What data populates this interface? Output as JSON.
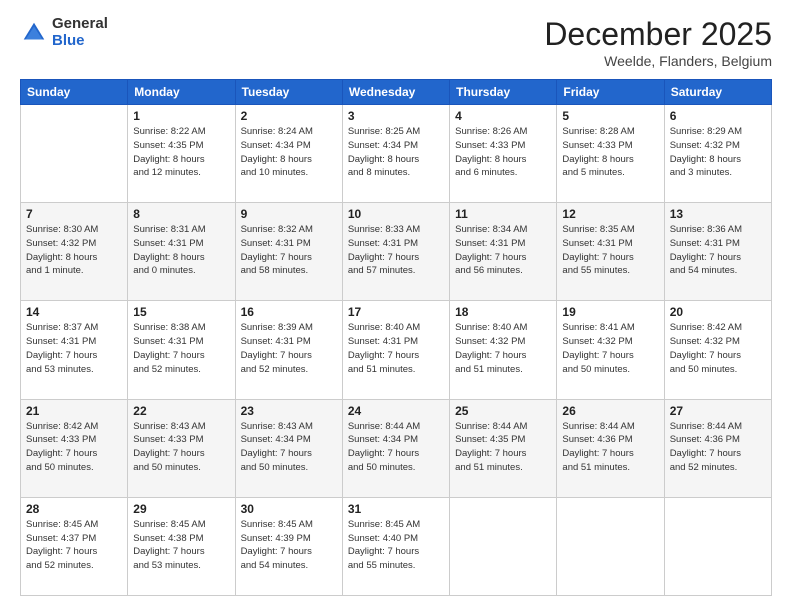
{
  "logo": {
    "general": "General",
    "blue": "Blue"
  },
  "header": {
    "month": "December 2025",
    "location": "Weelde, Flanders, Belgium"
  },
  "days_of_week": [
    "Sunday",
    "Monday",
    "Tuesday",
    "Wednesday",
    "Thursday",
    "Friday",
    "Saturday"
  ],
  "weeks": [
    [
      {
        "day": "",
        "info": ""
      },
      {
        "day": "1",
        "info": "Sunrise: 8:22 AM\nSunset: 4:35 PM\nDaylight: 8 hours\nand 12 minutes."
      },
      {
        "day": "2",
        "info": "Sunrise: 8:24 AM\nSunset: 4:34 PM\nDaylight: 8 hours\nand 10 minutes."
      },
      {
        "day": "3",
        "info": "Sunrise: 8:25 AM\nSunset: 4:34 PM\nDaylight: 8 hours\nand 8 minutes."
      },
      {
        "day": "4",
        "info": "Sunrise: 8:26 AM\nSunset: 4:33 PM\nDaylight: 8 hours\nand 6 minutes."
      },
      {
        "day": "5",
        "info": "Sunrise: 8:28 AM\nSunset: 4:33 PM\nDaylight: 8 hours\nand 5 minutes."
      },
      {
        "day": "6",
        "info": "Sunrise: 8:29 AM\nSunset: 4:32 PM\nDaylight: 8 hours\nand 3 minutes."
      }
    ],
    [
      {
        "day": "7",
        "info": "Sunrise: 8:30 AM\nSunset: 4:32 PM\nDaylight: 8 hours\nand 1 minute."
      },
      {
        "day": "8",
        "info": "Sunrise: 8:31 AM\nSunset: 4:31 PM\nDaylight: 8 hours\nand 0 minutes."
      },
      {
        "day": "9",
        "info": "Sunrise: 8:32 AM\nSunset: 4:31 PM\nDaylight: 7 hours\nand 58 minutes."
      },
      {
        "day": "10",
        "info": "Sunrise: 8:33 AM\nSunset: 4:31 PM\nDaylight: 7 hours\nand 57 minutes."
      },
      {
        "day": "11",
        "info": "Sunrise: 8:34 AM\nSunset: 4:31 PM\nDaylight: 7 hours\nand 56 minutes."
      },
      {
        "day": "12",
        "info": "Sunrise: 8:35 AM\nSunset: 4:31 PM\nDaylight: 7 hours\nand 55 minutes."
      },
      {
        "day": "13",
        "info": "Sunrise: 8:36 AM\nSunset: 4:31 PM\nDaylight: 7 hours\nand 54 minutes."
      }
    ],
    [
      {
        "day": "14",
        "info": "Sunrise: 8:37 AM\nSunset: 4:31 PM\nDaylight: 7 hours\nand 53 minutes."
      },
      {
        "day": "15",
        "info": "Sunrise: 8:38 AM\nSunset: 4:31 PM\nDaylight: 7 hours\nand 52 minutes."
      },
      {
        "day": "16",
        "info": "Sunrise: 8:39 AM\nSunset: 4:31 PM\nDaylight: 7 hours\nand 52 minutes."
      },
      {
        "day": "17",
        "info": "Sunrise: 8:40 AM\nSunset: 4:31 PM\nDaylight: 7 hours\nand 51 minutes."
      },
      {
        "day": "18",
        "info": "Sunrise: 8:40 AM\nSunset: 4:32 PM\nDaylight: 7 hours\nand 51 minutes."
      },
      {
        "day": "19",
        "info": "Sunrise: 8:41 AM\nSunset: 4:32 PM\nDaylight: 7 hours\nand 50 minutes."
      },
      {
        "day": "20",
        "info": "Sunrise: 8:42 AM\nSunset: 4:32 PM\nDaylight: 7 hours\nand 50 minutes."
      }
    ],
    [
      {
        "day": "21",
        "info": "Sunrise: 8:42 AM\nSunset: 4:33 PM\nDaylight: 7 hours\nand 50 minutes."
      },
      {
        "day": "22",
        "info": "Sunrise: 8:43 AM\nSunset: 4:33 PM\nDaylight: 7 hours\nand 50 minutes."
      },
      {
        "day": "23",
        "info": "Sunrise: 8:43 AM\nSunset: 4:34 PM\nDaylight: 7 hours\nand 50 minutes."
      },
      {
        "day": "24",
        "info": "Sunrise: 8:44 AM\nSunset: 4:34 PM\nDaylight: 7 hours\nand 50 minutes."
      },
      {
        "day": "25",
        "info": "Sunrise: 8:44 AM\nSunset: 4:35 PM\nDaylight: 7 hours\nand 51 minutes."
      },
      {
        "day": "26",
        "info": "Sunrise: 8:44 AM\nSunset: 4:36 PM\nDaylight: 7 hours\nand 51 minutes."
      },
      {
        "day": "27",
        "info": "Sunrise: 8:44 AM\nSunset: 4:36 PM\nDaylight: 7 hours\nand 52 minutes."
      }
    ],
    [
      {
        "day": "28",
        "info": "Sunrise: 8:45 AM\nSunset: 4:37 PM\nDaylight: 7 hours\nand 52 minutes."
      },
      {
        "day": "29",
        "info": "Sunrise: 8:45 AM\nSunset: 4:38 PM\nDaylight: 7 hours\nand 53 minutes."
      },
      {
        "day": "30",
        "info": "Sunrise: 8:45 AM\nSunset: 4:39 PM\nDaylight: 7 hours\nand 54 minutes."
      },
      {
        "day": "31",
        "info": "Sunrise: 8:45 AM\nSunset: 4:40 PM\nDaylight: 7 hours\nand 55 minutes."
      },
      {
        "day": "",
        "info": ""
      },
      {
        "day": "",
        "info": ""
      },
      {
        "day": "",
        "info": ""
      }
    ]
  ]
}
